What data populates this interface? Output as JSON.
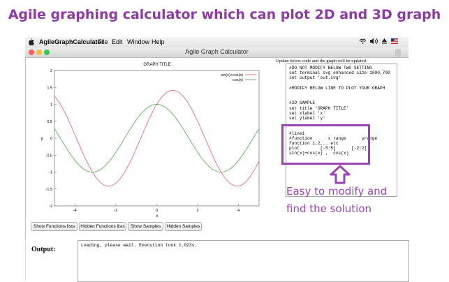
{
  "banner": "Agile graphing calculator which can plot 2D and 3D graph",
  "menubar": {
    "apple": "",
    "app_name": "AgileGraphCalculator",
    "items": [
      "File",
      "Edit",
      "Window",
      "Help"
    ],
    "status_icons": [
      "wifi-icon",
      "volume-icon",
      "eject-icon",
      "flag-icon"
    ]
  },
  "window": {
    "title": "Agile Graph Calculator",
    "lights": [
      "#fc605c",
      "#fdbc40",
      "#34c84a"
    ]
  },
  "chart_data": {
    "type": "line",
    "title": "GRAPH TITLE",
    "xlabel": "x",
    "ylabel": "y",
    "xlim": [
      -5,
      5
    ],
    "ylim": [
      -2,
      2
    ],
    "xticks": [
      "-4",
      "-2",
      "0",
      "2",
      "4"
    ],
    "yticks": [
      "2",
      "1.5",
      "1",
      "0.5",
      "0",
      "-0.5",
      "-1",
      "-1.5",
      "-2"
    ],
    "legend_placement": "top-right",
    "series": [
      {
        "name": "sin(x)+cos(x)",
        "color": "#e36b82",
        "function": "sin(x)+cos(x)"
      },
      {
        "name": "cos(x)",
        "color": "#5fae5a",
        "function": "cos(x)"
      }
    ]
  },
  "buttons": {
    "show_functions": "Show Functions lists",
    "hidden_functions": "Hidden Functions lists",
    "show_samples": "Show Samples",
    "hidden_samples": "Hidden Samples"
  },
  "editor": {
    "note": "Update below code and the graph will be updated.",
    "code": "#DO NOT MODIFY BELOW TWO SETTING\nset terminal svg enhanced size 1000,700\nset output 'out.svg'\n\n#MODIFY BELOW LINE TO PLOT YOUR GRAPH\n\n\n#2D SAMPLE\nset title 'GRAPH TITLE'\nset xlabel 'x'\nset ylabel 'y'\n\n\n#line1\n#function      x range      yrange\nfunction 1,2,.. etc\nplot        [-5:5]      [-2:2]\nsin(x)+cos(x) ,  cos(x)"
  },
  "annotation": {
    "line1": "Easy to modify and",
    "line2": "find the solution",
    "color": "#9b44b3"
  },
  "output": {
    "label": "Output:",
    "text": "Loading, please wait. Execution took 1.023s."
  }
}
